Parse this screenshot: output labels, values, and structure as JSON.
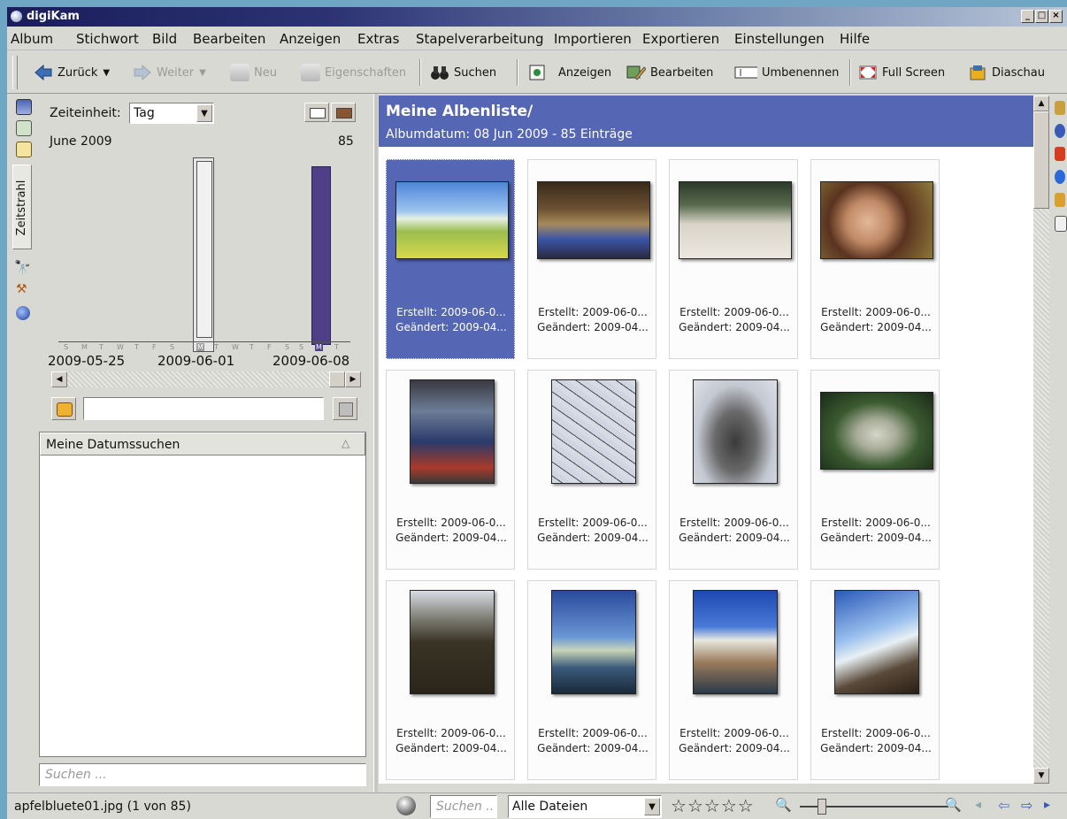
{
  "window": {
    "title": "digiKam"
  },
  "menu": [
    "Album",
    "Stichwort",
    "Bild",
    "Bearbeiten",
    "Anzeigen",
    "Extras",
    "Stapelverarbeitung",
    "Importieren",
    "Exportieren",
    "Einstellungen",
    "Hilfe"
  ],
  "toolbar": {
    "back": "Zurück",
    "forward": "Weiter",
    "new": "Neu",
    "properties": "Eigenschaften",
    "search": "Suchen",
    "view": "Anzeigen",
    "edit": "Bearbeiten",
    "rename": "Umbenennen",
    "fullscreen": "Full Screen",
    "slideshow": "Diaschau"
  },
  "leftpanel": {
    "tab_label": "Zeitstrahl",
    "time_unit_label": "Zeiteinheit:",
    "time_unit_value": "Tag",
    "month_label": "June 2009",
    "max_count": "85",
    "day_ticks": [
      "S",
      "M",
      "T",
      "W",
      "T",
      "F",
      "S",
      "M",
      "T",
      "W",
      "T",
      "F",
      "S",
      "S",
      "M",
      "T"
    ],
    "date_labels": [
      "2009-05-25",
      "2009-06-01",
      "2009-06-08"
    ],
    "saved_searches_header": "Meine Datumssuchen",
    "search_placeholder": "Suchen ..."
  },
  "album": {
    "title": "Meine Albenliste/",
    "subtitle": "Albumdatum: 08 Jun 2009 - 85 Einträge"
  },
  "thumbnails": [
    {
      "created": "Erstellt: 2009-06-0...",
      "modified": "Geändert: 2009-04...",
      "selected": true
    },
    {
      "created": "Erstellt: 2009-06-0...",
      "modified": "Geändert: 2009-04..."
    },
    {
      "created": "Erstellt: 2009-06-0...",
      "modified": "Geändert: 2009-04..."
    },
    {
      "created": "Erstellt: 2009-06-0...",
      "modified": "Geändert: 2009-04..."
    },
    {
      "created": "Erstellt: 2009-06-0...",
      "modified": "Geändert: 2009-04..."
    },
    {
      "created": "Erstellt: 2009-06-0...",
      "modified": "Geändert: 2009-04..."
    },
    {
      "created": "Erstellt: 2009-06-0...",
      "modified": "Geändert: 2009-04..."
    },
    {
      "created": "Erstellt: 2009-06-0...",
      "modified": "Geändert: 2009-04..."
    },
    {
      "created": "Erstellt: 2009-06-0...",
      "modified": "Geändert: 2009-04..."
    },
    {
      "created": "Erstellt: 2009-06-0...",
      "modified": "Geändert: 2009-04..."
    },
    {
      "created": "Erstellt: 2009-06-0...",
      "modified": "Geändert: 2009-04..."
    },
    {
      "created": "Erstellt: 2009-06-0...",
      "modified": "Geändert: 2009-04..."
    }
  ],
  "status": {
    "filename": "apfelbluete01.jpg (1 von 85)",
    "search_placeholder": "Suchen ..",
    "filter_value": "Alle Dateien"
  }
}
